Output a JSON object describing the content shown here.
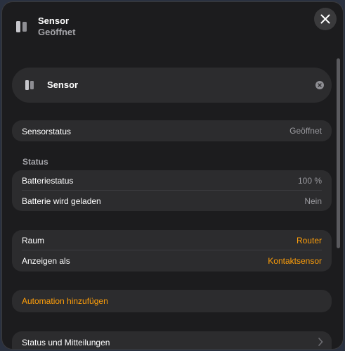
{
  "header": {
    "title": "Sensor",
    "subtitle": "Geöffnet",
    "icon": "contact-sensor-icon"
  },
  "name_card": {
    "name": "Sensor",
    "icon": "contact-sensor-icon"
  },
  "sensor_status": {
    "label": "Sensorstatus",
    "value": "Geöffnet"
  },
  "status_section": {
    "title": "Status",
    "rows": [
      {
        "label": "Batteriestatus",
        "value": "100 %"
      },
      {
        "label": "Batterie wird geladen",
        "value": "Nein"
      }
    ]
  },
  "location": {
    "rows": [
      {
        "label": "Raum",
        "value": "Router"
      },
      {
        "label": "Anzeigen als",
        "value": "Kontaktsensor"
      }
    ]
  },
  "automation": {
    "label": "Automation hinzufügen"
  },
  "notifications": {
    "label": "Status und Mitteilungen"
  },
  "colors": {
    "accent": "#ff9f0a",
    "background": "#1c1c1e",
    "card": "#2c2c2e"
  }
}
